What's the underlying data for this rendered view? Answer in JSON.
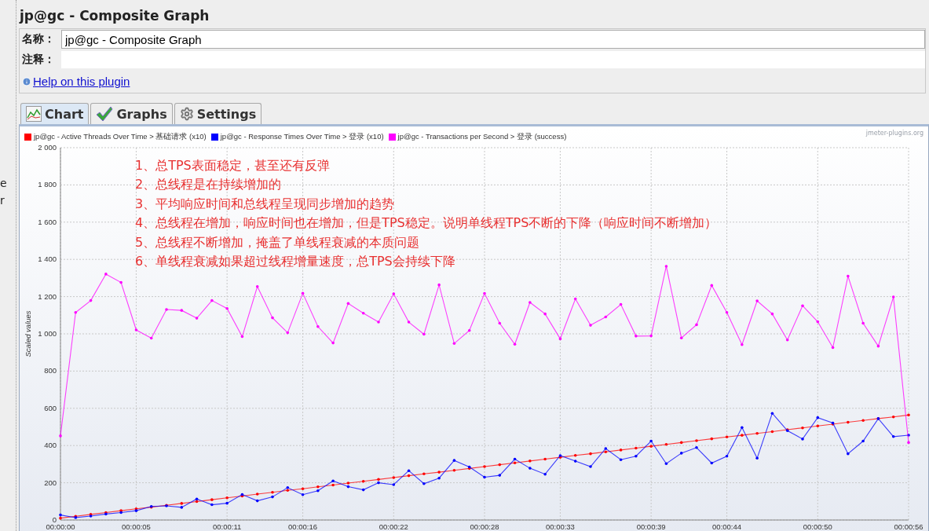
{
  "tree_fragments": [
    "e",
    "r"
  ],
  "title": "jp@gc - Composite Graph",
  "fields": [
    {
      "label": "名称：",
      "value": "jp@gc - Composite Graph"
    },
    {
      "label": "注释："
    }
  ],
  "help_link": "Help on this plugin",
  "tabs": [
    {
      "label": "Chart",
      "kind": "chart",
      "selected": true
    },
    {
      "label": "Graphs",
      "kind": "check",
      "selected": false
    },
    {
      "label": "Settings",
      "kind": "gear",
      "selected": false
    }
  ],
  "chart": {
    "credit": "jmeter-plugins.org",
    "annotations": [
      "1、总TPS表面稳定，甚至还有反弹",
      "2、总线程是在持续增加的",
      "3、平均响应时间和总线程呈现同步增加的趋势",
      "4、总线程在增加，响应时间也在增加，但是TPS稳定。说明单线程TPS不断的下降（响应时间不断增加）",
      "5、总线程不断增加，掩盖了单线程衰减的本质问题",
      "6、单线程衰减如果超过线程增量速度，总TPS会持续下降"
    ],
    "chart_data": {
      "type": "line",
      "grid": true,
      "ylabel": "Scaled values",
      "x": [
        0,
        1,
        2,
        3,
        4,
        5,
        6,
        7,
        8,
        9,
        10,
        11,
        12,
        13,
        14,
        15,
        16,
        17,
        18,
        19,
        20,
        21,
        22,
        23,
        24,
        25,
        26,
        27,
        28,
        29,
        30,
        31,
        32,
        33,
        34,
        35,
        36,
        37,
        38,
        39,
        40,
        41,
        42,
        43,
        44,
        45,
        46,
        47,
        48,
        49,
        50,
        51,
        52,
        53,
        54,
        55,
        56
      ],
      "xlim": [
        0,
        56
      ],
      "ylim": [
        0,
        2000
      ],
      "xticks": [
        {
          "value": 0,
          "label": "00:00:00"
        },
        {
          "value": 5,
          "label": "00:00:05"
        },
        {
          "value": 11,
          "label": "00:00:11"
        },
        {
          "value": 16,
          "label": "00:00:16"
        },
        {
          "value": 22,
          "label": "00:00:22"
        },
        {
          "value": 28,
          "label": "00:00:28"
        },
        {
          "value": 33,
          "label": "00:00:33"
        },
        {
          "value": 39,
          "label": "00:00:39"
        },
        {
          "value": 44,
          "label": "00:00:44"
        },
        {
          "value": 50,
          "label": "00:00:50"
        },
        {
          "value": 56,
          "label": "00:00:56"
        }
      ],
      "yticks": [
        {
          "value": 0,
          "label": "0"
        },
        {
          "value": 200,
          "label": "200"
        },
        {
          "value": 400,
          "label": "400"
        },
        {
          "value": 600,
          "label": "600"
        },
        {
          "value": 800,
          "label": "800"
        },
        {
          "value": 1000,
          "label": "1 000"
        },
        {
          "value": 1200,
          "label": "1 200"
        },
        {
          "value": 1400,
          "label": "1 400"
        },
        {
          "value": 1600,
          "label": "1 600"
        },
        {
          "value": 1800,
          "label": "1 800"
        },
        {
          "value": 2000,
          "label": "2 000"
        }
      ],
      "series": [
        {
          "name": "jp@gc - Active Threads Over Time > 基础请求 (x10)",
          "color": "#ff0000",
          "values": [
            10,
            20,
            30,
            40,
            50,
            60,
            69,
            79,
            89,
            99,
            109,
            119,
            129,
            139,
            149,
            159,
            168,
            178,
            188,
            198,
            208,
            218,
            228,
            238,
            248,
            257,
            267,
            277,
            287,
            297,
            307,
            317,
            327,
            337,
            347,
            356,
            366,
            376,
            386,
            396,
            406,
            416,
            426,
            436,
            446,
            455,
            465,
            475,
            485,
            495,
            505,
            515,
            525,
            535,
            545,
            554,
            564
          ]
        },
        {
          "name": "jp@gc - Response Times Over Time > 登录 (x10)",
          "color": "#0000ff",
          "values": [
            27,
            13,
            21,
            32,
            40,
            50,
            73,
            76,
            68,
            113,
            82,
            90,
            137,
            103,
            124,
            174,
            136,
            157,
            210,
            179,
            162,
            200,
            190,
            265,
            195,
            225,
            320,
            285,
            230,
            240,
            327,
            278,
            246,
            346,
            316,
            287,
            384,
            324,
            343,
            424,
            303,
            359,
            389,
            306,
            343,
            497,
            332,
            573,
            480,
            435,
            550,
            521,
            356,
            424,
            545,
            448,
            456
          ]
        },
        {
          "name": "jp@gc - Transactions per Second > 登录 (success)",
          "color": "#ff00ff",
          "values": [
            452,
            1115,
            1179,
            1321,
            1276,
            1021,
            977,
            1131,
            1126,
            1084,
            1179,
            1136,
            985,
            1254,
            1086,
            1006,
            1218,
            1039,
            951,
            1163,
            1111,
            1063,
            1215,
            1063,
            998,
            1263,
            948,
            1018,
            1217,
            1057,
            944,
            1169,
            1107,
            973,
            1188,
            1046,
            1091,
            1158,
            988,
            989,
            1363,
            978,
            1049,
            1260,
            1115,
            942,
            1177,
            1107,
            967,
            1151,
            1065,
            926,
            1310,
            1057,
            934,
            1198,
            416
          ]
        }
      ]
    }
  }
}
